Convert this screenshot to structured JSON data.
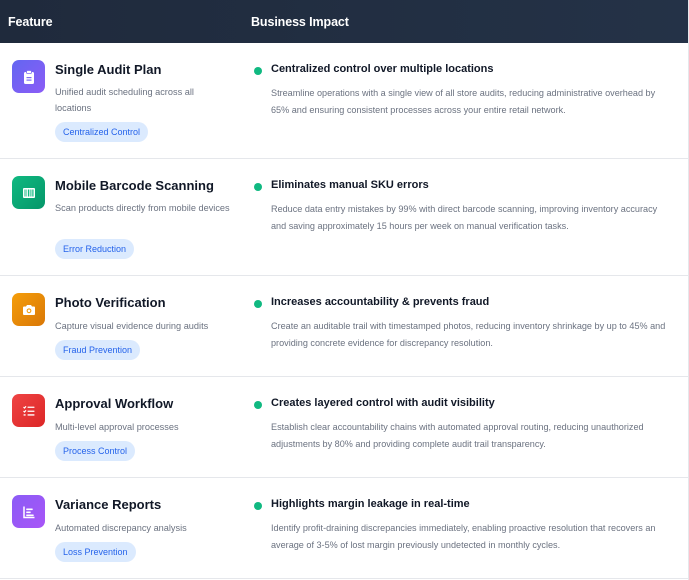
{
  "header": {
    "feature": "Feature",
    "impact": "Business Impact"
  },
  "rows": [
    {
      "icon": "clipboard-icon",
      "color": "#6366f1",
      "title": "Single Audit Plan",
      "desc": "Unified audit scheduling across all locations",
      "tag": "Centralized Control",
      "impact_title": "Centralized control over multiple locations",
      "impact_desc": "Streamline operations with a single view of all store audits, reducing administrative overhead by 65% and ensuring consistent processes across your entire retail network."
    },
    {
      "icon": "barcode-icon",
      "color": "#10b981",
      "title": "Mobile Barcode Scanning",
      "desc": "Scan products directly from mobile devices",
      "tag": "Error Reduction",
      "impact_title": "Eliminates manual SKU errors",
      "impact_desc": "Reduce data entry mistakes by 99% with direct barcode scanning, improving inventory accuracy and saving approximately 15 hours per week on manual verification tasks."
    },
    {
      "icon": "camera-icon",
      "color": "#f59e0b",
      "title": "Photo Verification",
      "desc": "Capture visual evidence during audits",
      "tag": "Fraud Prevention",
      "impact_title": "Increases accountability & prevents fraud",
      "impact_desc": "Create an auditable trail with timestamped photos, reducing inventory shrinkage by up to 45% and providing concrete evidence for discrepancy resolution."
    },
    {
      "icon": "checklist-icon",
      "color": "#ef4444",
      "title": "Approval Workflow",
      "desc": "Multi-level approval processes",
      "tag": "Process Control",
      "impact_title": "Creates layered control with audit visibility",
      "impact_desc": "Establish clear accountability chains with automated approval routing, reducing unauthorized adjustments by 80% and providing complete audit trail transparency."
    },
    {
      "icon": "chart-icon",
      "color": "#8b5cf6",
      "title": "Variance Reports",
      "desc": "Automated discrepancy analysis",
      "tag": "Loss Prevention",
      "impact_title": "Highlights margin leakage in real-time",
      "impact_desc": "Identify profit-draining discrepancies immediately, enabling proactive resolution that recovers an average of 3-5% of lost margin previously undetected in monthly cycles."
    }
  ]
}
